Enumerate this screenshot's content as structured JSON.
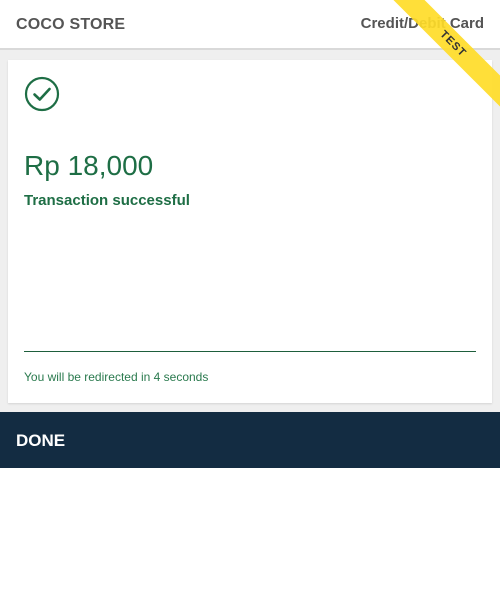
{
  "header": {
    "store_name": "COCO STORE",
    "payment_method": "Credit/Debit Card",
    "test_badge": "TEST"
  },
  "transaction": {
    "icon": "check-circle-icon",
    "amount": "Rp 18,000",
    "status": "Transaction successful",
    "redirect_message": "You will be redirected in 4 seconds"
  },
  "footer": {
    "done_label": "DONE"
  },
  "colors": {
    "success_green": "#1e6e45",
    "done_bar": "#132c42",
    "test_ribbon": "#ffdc28"
  }
}
